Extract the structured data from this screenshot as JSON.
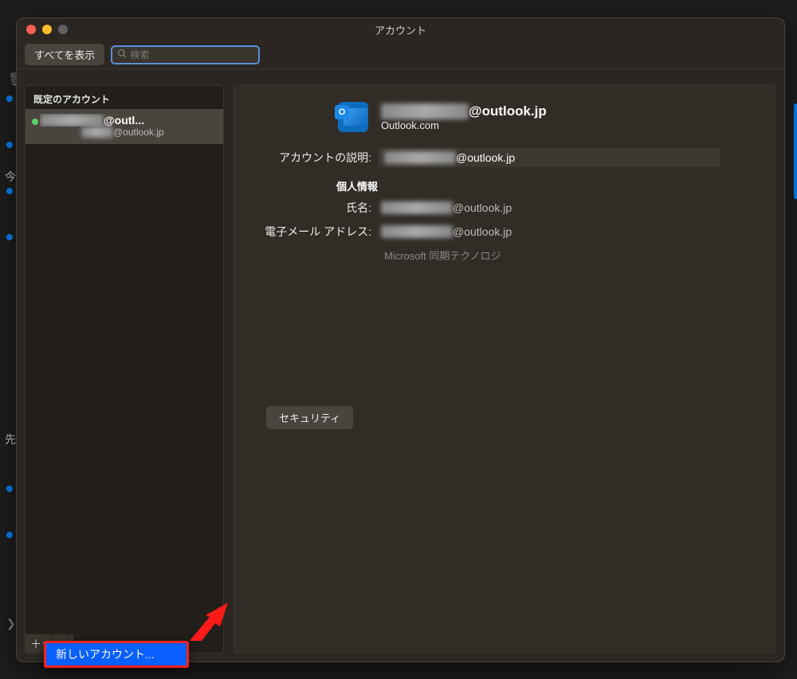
{
  "window": {
    "title": "アカウント"
  },
  "toolbar": {
    "show_all": "すべてを表示",
    "search_placeholder": "検索"
  },
  "sidebar": {
    "header": "既定のアカウント",
    "accounts": [
      {
        "name_suffix": "@outl...",
        "sub_suffix": "@outlook.jp"
      }
    ],
    "footer": {
      "add": "＋",
      "remove": "−"
    }
  },
  "detail": {
    "header_suffix": "@outlook.jp",
    "header_service": "Outlook.com",
    "labels": {
      "description": "アカウントの説明:",
      "personal_info": "個人情報",
      "name": "氏名:",
      "email": "電子メール アドレス:"
    },
    "values": {
      "description_suffix": "@outlook.jp",
      "name_suffix": "@outlook.jp",
      "email_suffix": "@outlook.jp"
    },
    "sync_note": "Microsoft 同期テクノロジ",
    "security_button": "セキュリティ"
  },
  "popup": {
    "new_account": "新しいアカウント..."
  },
  "bg": {
    "label1": "今",
    "label2": "先"
  }
}
